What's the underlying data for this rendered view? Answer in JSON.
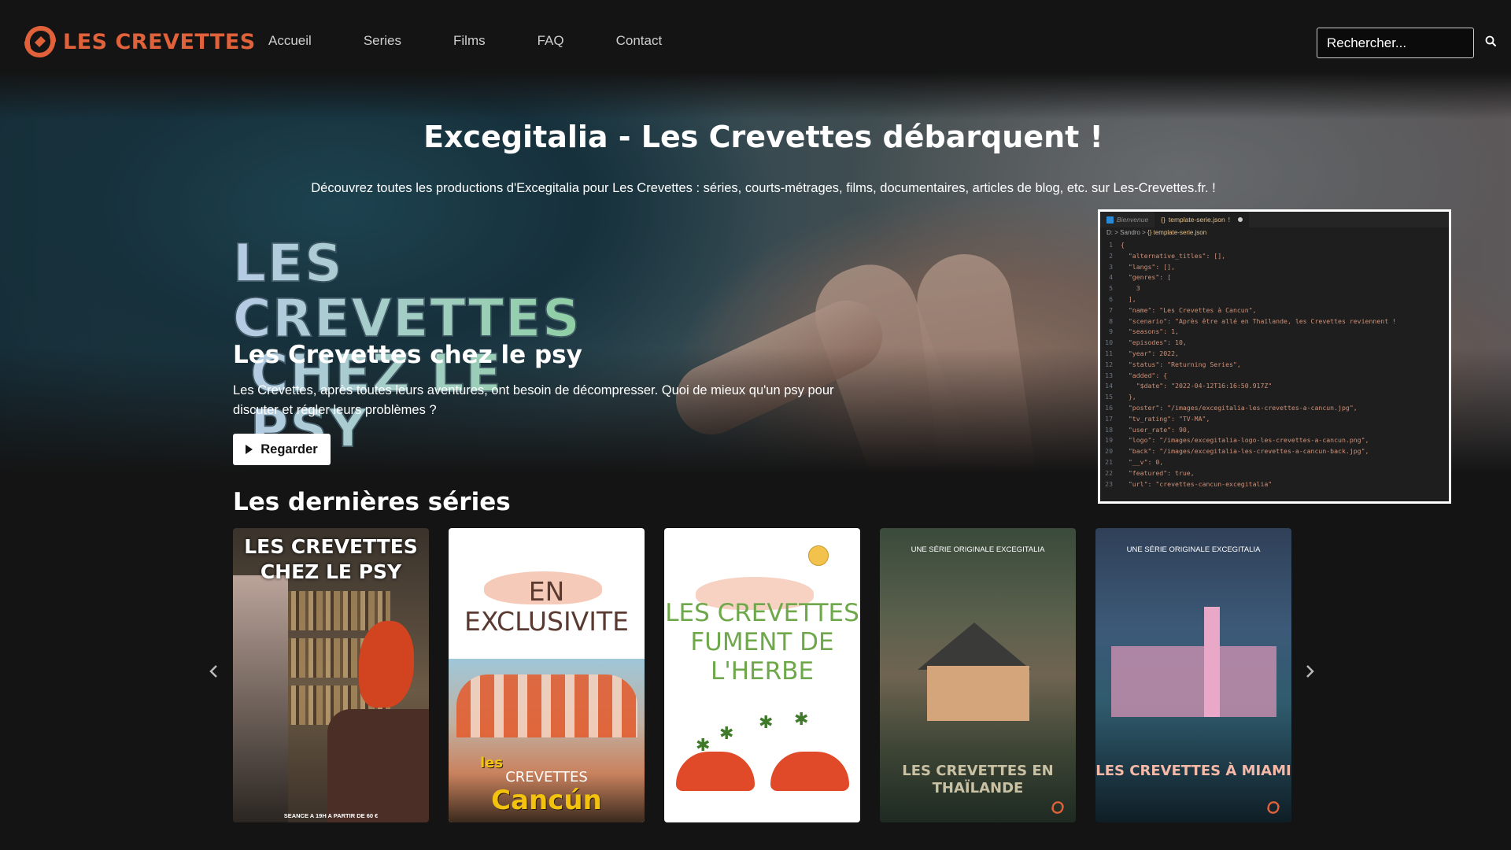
{
  "nav": {
    "brand": "LES CREVETTES",
    "links": [
      "Accueil",
      "Series",
      "Films",
      "FAQ",
      "Contact"
    ],
    "search_placeholder": "Rechercher..."
  },
  "hero": {
    "title": "Excegitalia - Les Crevettes débarquent !",
    "description": "Découvrez toutes les productions d'Excegitalia pour Les Crevettes : séries, courts-métrages, films, documentaires, articles de blog, etc. sur Les-Crevettes.fr. !",
    "logo_line1": "LES CREVETTES",
    "logo_line2": "CHEZ LE PSY",
    "show_title": "Les Crevettes chez le psy",
    "show_description": "Les Crevettes, après toutes leurs aventures, ont besoin de décompresser. Quoi de mieux qu'un psy pour discuter et régler leurs problèmes ?",
    "watch_label": "Regarder"
  },
  "editor": {
    "tab_welcome": "Bienvenue",
    "tab_file": "template-serie.json",
    "tab_file_marker": "!",
    "path_root": "D: > Sandro >",
    "path_file": "{} template-serie.json",
    "lines": [
      {
        "n": "1",
        "text": "{"
      },
      {
        "n": "2",
        "text": "  \"alternative_titles\": [],"
      },
      {
        "n": "3",
        "text": "  \"langs\": [],"
      },
      {
        "n": "4",
        "text": "  \"genres\": ["
      },
      {
        "n": "5",
        "text": "    3"
      },
      {
        "n": "6",
        "text": "  ],"
      },
      {
        "n": "7",
        "text": "  \"name\": \"Les Crevettes à Cancun\","
      },
      {
        "n": "8",
        "text": "  \"scenario\": \"Après être allé en Thaïlande, les Crevettes reviennent !"
      },
      {
        "n": "9",
        "text": "  \"seasons\": 1,"
      },
      {
        "n": "10",
        "text": "  \"episodes\": 10,"
      },
      {
        "n": "11",
        "text": "  \"year\": 2022,"
      },
      {
        "n": "12",
        "text": "  \"status\": \"Returning Series\","
      },
      {
        "n": "13",
        "text": "  \"added\": {"
      },
      {
        "n": "14",
        "text": "    \"$date\": \"2022-04-12T16:16:50.917Z\""
      },
      {
        "n": "15",
        "text": "  },"
      },
      {
        "n": "16",
        "text": "  \"poster\": \"/images/excegitalia-les-crevettes-a-cancun.jpg\","
      },
      {
        "n": "17",
        "text": "  \"tv_rating\": \"TV-MA\","
      },
      {
        "n": "18",
        "text": "  \"user_rate\": 90,"
      },
      {
        "n": "19",
        "text": "  \"logo\": \"/images/excegitalia-logo-les-crevettes-a-cancun.png\","
      },
      {
        "n": "20",
        "text": "  \"back\": \"/images/excegitalia-les-crevettes-a-cancun-back.jpg\","
      },
      {
        "n": "21",
        "text": "  \"__v\": 0,"
      },
      {
        "n": "22",
        "text": "  \"featured\": true,"
      },
      {
        "n": "23",
        "text": "  \"url\": \"crevettes-cancun-excegitalia\""
      }
    ]
  },
  "latest": {
    "title": "Les dernières séries",
    "cards": [
      {
        "title": "LES CREVETTES CHEZ LE PSY",
        "footer": "SEANCE A 19H A PARTIR DE 60 €"
      },
      {
        "title": "EN EXCLUSIVITE",
        "brand_top": "les",
        "brand_mid": "CREVETTES",
        "brand_bottom": "Cancún"
      },
      {
        "title": "LES CREVETTES FUMENT DE L'HERBE"
      },
      {
        "subtitle": "UNE SÉRIE ORIGINALE EXCEGITALIA",
        "title": "LES CREVETTES EN THAÏLANDE"
      },
      {
        "subtitle": "UNE SÉRIE ORIGINALE EXCEGITALIA",
        "title": "LES CREVETTES À MIAMI"
      }
    ]
  },
  "colors": {
    "brand": "#e0613a",
    "background": "#141414",
    "accent_green": "#6fa84a"
  },
  "icons": [
    "logo-shrimp-icon",
    "search-icon",
    "play-icon",
    "chevron-left-icon",
    "chevron-right-icon"
  ]
}
